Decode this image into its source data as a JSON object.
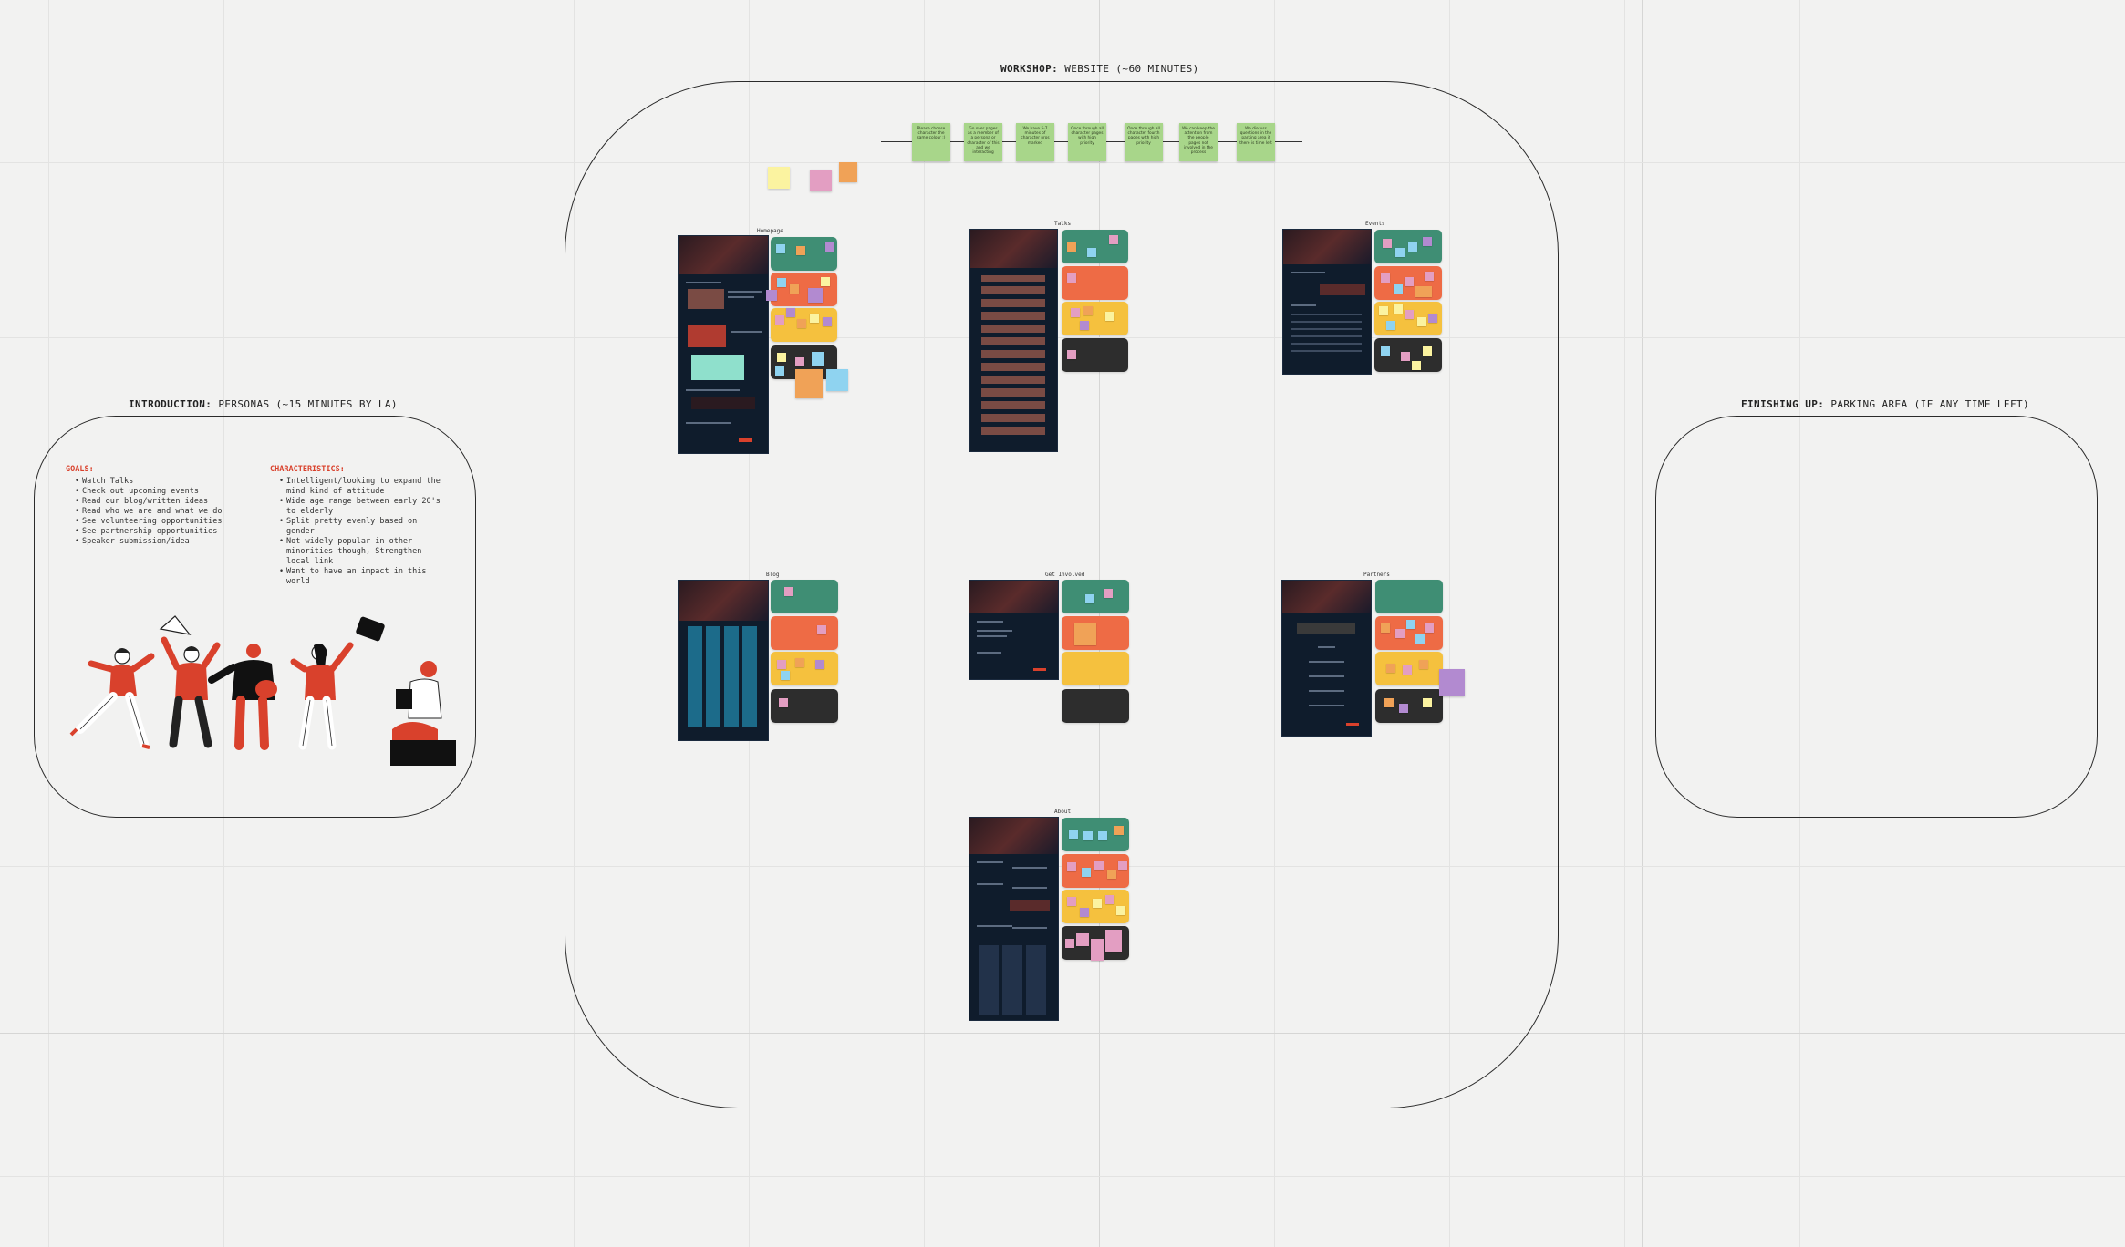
{
  "sections": {
    "intro": {
      "bold": "INTRODUCTION:",
      "rest": "PERSONAS (~15 MINUTES BY LA)"
    },
    "workshop": {
      "bold": "WORKSHOP:",
      "rest": "WEBSITE (~60 MINUTES)"
    },
    "finishing": {
      "bold": "FINISHING UP:",
      "rest": "PARKING AREA (IF ANY TIME LEFT)"
    }
  },
  "personas": {
    "goals_heading": "GOALS:",
    "goals": [
      "Watch Talks",
      "Check out upcoming events",
      "Read our blog/written ideas",
      "Read who we are and what we do",
      "See volunteering opportunities",
      "See partnership opportunities",
      "Speaker submission/idea"
    ],
    "characteristics_heading": "CHARACTERISTICS:",
    "characteristics": [
      "Intelligent/looking to expand the mind kind of attitude",
      "Wide age range between early 20's to elderly",
      "Split pretty evenly based on gender",
      "Not widely popular in other minorities though, Strengthen local link",
      "Want to have an impact in this world"
    ]
  },
  "timeline_notes": [
    "Please choose character the same colour :)",
    "Go over pages as a member of a persona or character of this and we interacting",
    "We have 5-7 minutes of character pros marked",
    "Once through all character pages with high priority",
    "Once through all character fourth pages with high priority",
    "We can keep the attention from the people pages not involved in the process",
    "We discuss questions in the parking area if there is time left"
  ],
  "pages": [
    {
      "id": "homepage",
      "label": "Homepage"
    },
    {
      "id": "talks",
      "label": "Talks"
    },
    {
      "id": "events",
      "label": "Events"
    },
    {
      "id": "blog",
      "label": "Blog"
    },
    {
      "id": "get-involved",
      "label": "Get Involved"
    },
    {
      "id": "partners",
      "label": "Partners"
    },
    {
      "id": "about",
      "label": "About"
    }
  ],
  "colors": {
    "canvas": "#f2f2f1",
    "accent_red": "#d9412c",
    "sticky_green": "#a8d68a",
    "card_green": "#3f8e74",
    "card_orange": "#ee6b45",
    "card_yellow": "#f5c13e",
    "card_dark": "#2d2d2d",
    "sticky_pink": "#e39ec2",
    "sticky_blue": "#8fd3f0",
    "sticky_purple": "#b28ad0",
    "sticky_light_yellow": "#fbf3a0",
    "sticky_orange": "#f0a257",
    "mockup_navy": "#0f1c2c"
  }
}
